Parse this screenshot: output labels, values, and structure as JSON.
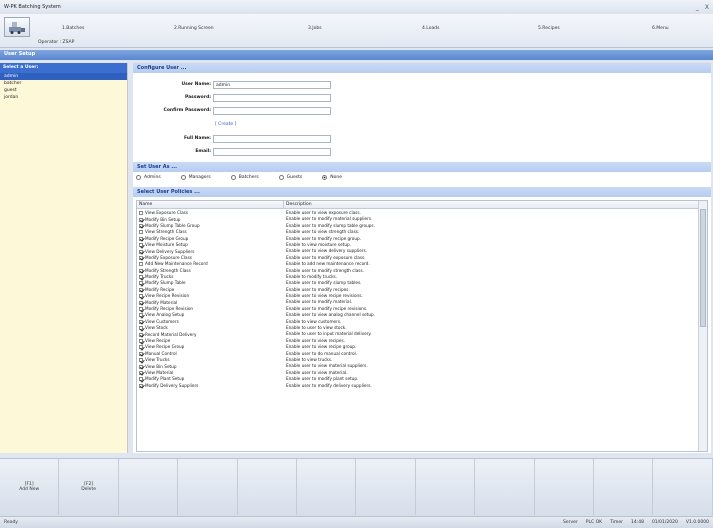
{
  "window": {
    "title": "W-PK Batching System",
    "controls": [
      "_",
      "X"
    ]
  },
  "menubar": {
    "operator": "Operator : ZSAP",
    "items": [
      {
        "label": "1.Batches"
      },
      {
        "label": "2.Running Screen"
      },
      {
        "label": "3.Jobs"
      },
      {
        "label": "4.Loads"
      },
      {
        "label": "5.Recipes"
      },
      {
        "label": "6.Menu"
      }
    ]
  },
  "section_title": "User Setup",
  "users": {
    "header": "Select a User:",
    "list": [
      "admin",
      "batcher",
      "guest",
      "jordan"
    ],
    "selected": "admin"
  },
  "configure": {
    "title": "Configure User ...",
    "labels": {
      "user_name": "User Name:",
      "password": "Password:",
      "confirm_password": "Confirm Password:",
      "full_name": "Full Name:",
      "email": "Email:"
    },
    "values": {
      "user_name": "admin",
      "password": "",
      "confirm_password": "",
      "full_name": "",
      "email": ""
    },
    "clear_link": "[ Create ]"
  },
  "user_as": {
    "title": "Set User As ...",
    "options": [
      "Admins",
      "Managers",
      "Batchers",
      "Guests",
      "None"
    ],
    "selected": "None"
  },
  "policies": {
    "title": "Select User Policies ...",
    "columns": [
      "Name",
      "Description"
    ],
    "rows": [
      {
        "name": "View Exposure Class",
        "desc": "Enable user to view exposure class.",
        "checked": false
      },
      {
        "name": "Modify Bin Setup",
        "desc": "Enable user to modify material suppliers.",
        "checked": true
      },
      {
        "name": "Modify Slump Table Group",
        "desc": "Enable user to modify slump table groups.",
        "checked": true
      },
      {
        "name": "View Strength Class",
        "desc": "Enable user to view strength class.",
        "checked": false
      },
      {
        "name": "Modify Recipe Group",
        "desc": "Enable user to modify recipe group.",
        "checked": true
      },
      {
        "name": "View Moisture Setup",
        "desc": "Enable to view moisture setup.",
        "checked": true
      },
      {
        "name": "View Delivery Suppliers",
        "desc": "Enable user to view delivery suppliers.",
        "checked": true
      },
      {
        "name": "Modify Exposure Class",
        "desc": "Enable user to modify exposure class.",
        "checked": true
      },
      {
        "name": "Add New Maintenance Record",
        "desc": "Enable to add new maintenance record.",
        "checked": false
      },
      {
        "name": "Modify Strength Class",
        "desc": "Enable user to modify strength class.",
        "checked": true
      },
      {
        "name": "Modify Trucks",
        "desc": "Enable to modify trucks.",
        "checked": true
      },
      {
        "name": "Modify Slump Table",
        "desc": "Enable user to modify slump tables.",
        "checked": true
      },
      {
        "name": "Modify Recipe",
        "desc": "Enable user to modify recipes.",
        "checked": true
      },
      {
        "name": "View Recipe Revision",
        "desc": "Enable user to view recipe revisions.",
        "checked": true
      },
      {
        "name": "Modify Material",
        "desc": "Enable user to modify material.",
        "checked": true
      },
      {
        "name": "Modify Recipe Revision",
        "desc": "Enable user to modify recipe revisions.",
        "checked": true
      },
      {
        "name": "View Analog Setup",
        "desc": "Enable user to view analog channel setup.",
        "checked": true
      },
      {
        "name": "View Customers",
        "desc": "Enable to view customers.",
        "checked": true
      },
      {
        "name": "View Stock",
        "desc": "Enable to user to view stock.",
        "checked": true
      },
      {
        "name": "Record Material Delivery",
        "desc": "Enable to user to input material delivery.",
        "checked": true
      },
      {
        "name": "View Recipe",
        "desc": "Enable user to view recipes.",
        "checked": true
      },
      {
        "name": "View Recipe Group",
        "desc": "Enable user to view recipe group.",
        "checked": true
      },
      {
        "name": "Manual Control",
        "desc": "Enable user to do manual control.",
        "checked": true
      },
      {
        "name": "View Trucks",
        "desc": "Enable to view trucks.",
        "checked": true
      },
      {
        "name": "View Bin Setup",
        "desc": "Enable user to view material suppliers.",
        "checked": true
      },
      {
        "name": "View Material",
        "desc": "Enable user to view material.",
        "checked": true
      },
      {
        "name": "Modify Plant Setup",
        "desc": "Enable user to modify plant setup.",
        "checked": true
      },
      {
        "name": "Modify Delivery Suppliers",
        "desc": "Enable user to modify delivery suppliers.",
        "checked": true
      }
    ]
  },
  "function_keys": [
    {
      "key": "[F1]",
      "label": "Add New"
    },
    {
      "key": "[F2]",
      "label": "Delete"
    },
    {
      "key": "",
      "label": ""
    },
    {
      "key": "",
      "label": ""
    },
    {
      "key": "",
      "label": ""
    },
    {
      "key": "",
      "label": ""
    },
    {
      "key": "",
      "label": ""
    },
    {
      "key": "",
      "label": ""
    },
    {
      "key": "",
      "label": ""
    },
    {
      "key": "",
      "label": ""
    },
    {
      "key": "",
      "label": ""
    },
    {
      "key": "",
      "label": ""
    }
  ],
  "status": {
    "left": "Ready",
    "right": [
      "Server",
      "PLC OK",
      "Timer",
      "14:48",
      "01/01/2020",
      "V1.0.0000"
    ]
  }
}
